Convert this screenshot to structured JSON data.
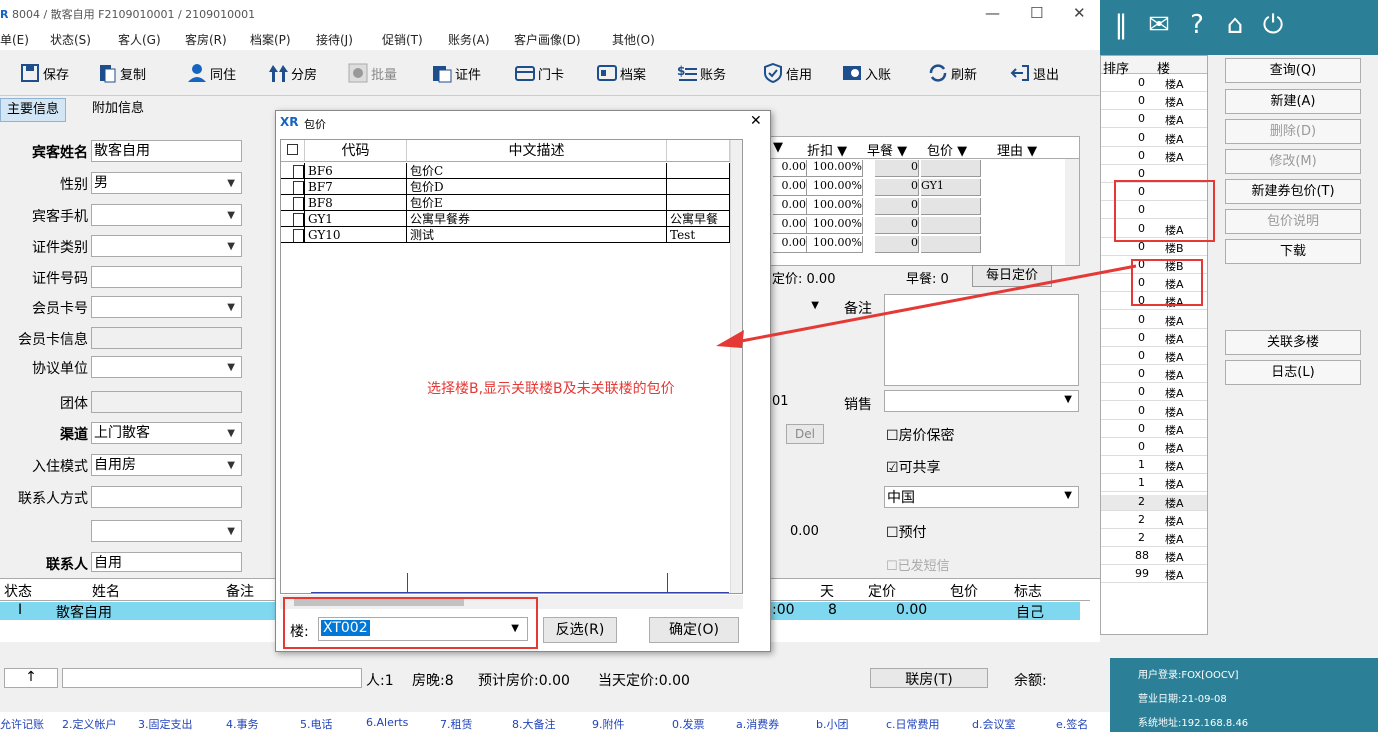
{
  "window": {
    "title_prefix": "R",
    "title": "8004 / 散客自用 F2109010001 / 2109010001",
    "min": "—",
    "max": "☐",
    "close": "✕"
  },
  "menu": [
    "单(E)",
    "状态(S)",
    "客人(G)",
    "客房(R)",
    "档案(P)",
    "接待(J)",
    "促销(T)",
    "账务(A)",
    "客户画像(D)",
    "其他(O)"
  ],
  "toolbar": {
    "save": "保存",
    "copy": "复制",
    "cohabit": "同住",
    "split": "分房",
    "batch": "批量",
    "cert": "证件",
    "doorcard": "门卡",
    "archive": "档案",
    "account": "账务",
    "credit": "信用",
    "checkin": "入账",
    "refresh": "刷新",
    "exit": "退出"
  },
  "tabs": {
    "main": "主要信息",
    "extra": "附加信息"
  },
  "form": {
    "guest_name_label": "宾客姓名",
    "guest_name": "散客自用",
    "gender_label": "性别",
    "gender": "男",
    "phone_label": "宾客手机",
    "idtype_label": "证件类别",
    "idno_label": "证件号码",
    "member_label": "会员卡号",
    "member_info_label": "会员卡信息",
    "agreement_label": "协议单位",
    "group_label": "团体",
    "channel_label": "渠道",
    "channel": "上门散客",
    "mode_label": "入住模式",
    "mode": "自用房",
    "contact_label": "联系人方式",
    "contact_person_label": "联系人",
    "contact_person": "自用"
  },
  "right_table": {
    "headers": [
      "▼",
      "折扣 ▼",
      "早餐 ▼",
      "包价 ▼",
      "理由 ▼"
    ],
    "rows": [
      [
        "0.00",
        "100.00%",
        "0",
        ""
      ],
      [
        "0.00",
        "100.00%",
        "0",
        "GY1"
      ],
      [
        "0.00",
        "100.00%",
        "0",
        ""
      ],
      [
        "0.00",
        "100.00%",
        "0",
        ""
      ],
      [
        "0.00",
        "100.00%",
        "0",
        ""
      ]
    ],
    "fixed_price_label": "定价:",
    "fixed_price": "0.00",
    "breakfast_label": "早餐:",
    "breakfast": "0",
    "daily_button": "每日定价"
  },
  "right_form": {
    "remark_label": "备注",
    "sales_label": "销售",
    "arrow": "->",
    "val01": "01",
    "del": "Del",
    "price_secret": "房价保密",
    "shareable": "可共享",
    "country": "中国",
    "prepay": "预付",
    "sms": "已发短信",
    "amount": "0.00"
  },
  "lower_table": {
    "headers": [
      "状态",
      "姓名",
      "备注"
    ],
    "row": [
      "I",
      "散客自用"
    ],
    "right_headers": [
      "天",
      "定价",
      "包价",
      "标志"
    ],
    "right_row": [
      ":00",
      "8",
      "0.00",
      "",
      "自己"
    ]
  },
  "summary": {
    "up": "↑",
    "persons": "人:1",
    "nights": "房晚:8",
    "est": "预计房价:0.00",
    "today": "当天定价:0.00",
    "link_room": "联房(T)",
    "balance": "余额:"
  },
  "bottom_tabs": [
    "允许记账",
    "2.定义帐户",
    "3.固定支出",
    "4.事务",
    "5.电话",
    "6.Alerts",
    "7.租赁",
    "8.大备注",
    "9.附件",
    "0.发票",
    "a.消费券",
    "b.小团",
    "c.日常费用",
    "d.会议室",
    "e.签名"
  ],
  "side_grid": {
    "header_left": "排序",
    "header_right": "楼",
    "rows": [
      [
        "0",
        "楼A"
      ],
      [
        "0",
        "楼A"
      ],
      [
        "0",
        "楼A"
      ],
      [
        "0",
        "楼A"
      ],
      [
        "0",
        "楼A"
      ],
      [
        "0",
        ""
      ],
      [
        "0",
        ""
      ],
      [
        "0",
        ""
      ],
      [
        "0",
        "楼A"
      ],
      [
        "0",
        "楼B"
      ],
      [
        "0",
        "楼B"
      ],
      [
        "0",
        "楼A"
      ],
      [
        "0",
        "楼A"
      ],
      [
        "0",
        "楼A"
      ],
      [
        "0",
        "楼A"
      ],
      [
        "0",
        "楼A"
      ],
      [
        "0",
        "楼A"
      ],
      [
        "0",
        "楼A"
      ],
      [
        "0",
        "楼A"
      ],
      [
        "0",
        "楼A"
      ],
      [
        "0",
        "楼A"
      ],
      [
        "1",
        "楼A"
      ],
      [
        "1",
        "楼A"
      ],
      [
        "2",
        "楼A"
      ],
      [
        "2",
        "楼A"
      ],
      [
        "2",
        "楼A"
      ],
      [
        "88",
        "楼A"
      ],
      [
        "99",
        "楼A"
      ]
    ]
  },
  "side_buttons": {
    "query": "查询(Q)",
    "new": "新建(A)",
    "delete": "删除(D)",
    "modify": "修改(M)",
    "new_pkg": "新建券包价(T)",
    "pkg_desc": "包价说明",
    "download": "下载",
    "link_multi": "关联多楼",
    "log": "日志(L)"
  },
  "status": {
    "user_label": "用户登录:",
    "user": "FOX[OOCV]",
    "date_label": "营业日期:",
    "date": "21-09-08",
    "ip_label": "系统地址:",
    "ip": "192.168.8.46"
  },
  "dialog": {
    "title": "包价",
    "close": "✕",
    "headers": [
      "代码",
      "中文描述",
      ""
    ],
    "rows": [
      [
        "BF6",
        "包价C",
        ""
      ],
      [
        "BF7",
        "包价D",
        ""
      ],
      [
        "BF8",
        "包价E",
        ""
      ],
      [
        "GY1",
        "公寓早餐券",
        "公寓早餐"
      ],
      [
        "GY10",
        "测试",
        "Test"
      ]
    ],
    "building_label": "楼:",
    "building_value": "XT002",
    "invert_button": "反选(R)",
    "ok_button": "确定(O)"
  },
  "annotation": {
    "text": "选择楼B,显示关联楼B及未关联楼的包价"
  },
  "colors": {
    "accent": "#2b7f96",
    "highlight": "#7fd8f0",
    "annotation": "#e53935",
    "selection": "#0078d7"
  }
}
